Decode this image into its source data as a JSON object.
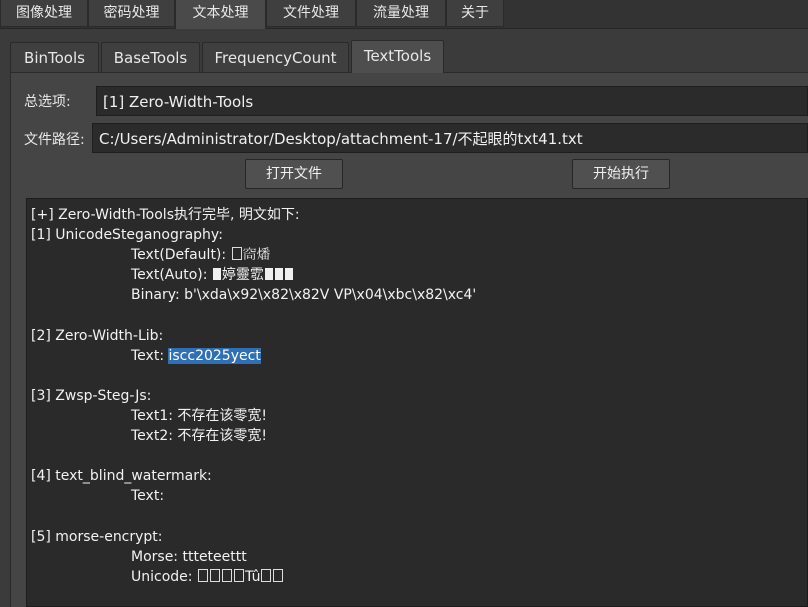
{
  "top_tabs": [
    "图像处理",
    "密码处理",
    "文本处理",
    "文件处理",
    "流量处理",
    "关于"
  ],
  "sub_tabs": [
    "BinTools",
    "BaseTools",
    "FrequencyCount",
    "TextTools"
  ],
  "form": {
    "option_label": "总选项:",
    "option_value": "[1] Zero-Width-Tools",
    "path_label": "文件路径:",
    "path_value": "C:/Users/Administrator/Desktop/attachment-17/不起眼的txt41.txt",
    "open_button": "打开文件",
    "run_button": "开始执行"
  },
  "output": {
    "line1": "[+] Zero-Width-Tools执行完毕, 明文如下:",
    "s1_title": "[1] UnicodeSteganography:",
    "s1_text_default_label": "Text(Default): ",
    "s1_text_default_value": "𥥩燔",
    "s1_text_auto_label": "Text(Auto): ",
    "s1_text_auto_value": "婷靈䨎",
    "s1_binary": "Binary: b'\\xda\\x92\\x82\\x82V VP\\x04\\xbc\\x82\\xc4'",
    "s2_title": "[2] Zero-Width-Lib:",
    "s2_text_label": "Text: ",
    "s2_text_value": "iscc2025yect",
    "s3_title": "[3] Zwsp-Steg-Js:",
    "s3_text1": "Text1: 不存在该零宽!",
    "s3_text2": "Text2: 不存在该零宽!",
    "s4_title": "[4] text_blind_watermark:",
    "s4_text": "Text:",
    "s5_title": "[5] morse-encrypt:",
    "s5_morse": "Morse: ttteteettt",
    "s5_unicode_label": "Unicode: ",
    "s5_unicode_value": "Tû"
  }
}
